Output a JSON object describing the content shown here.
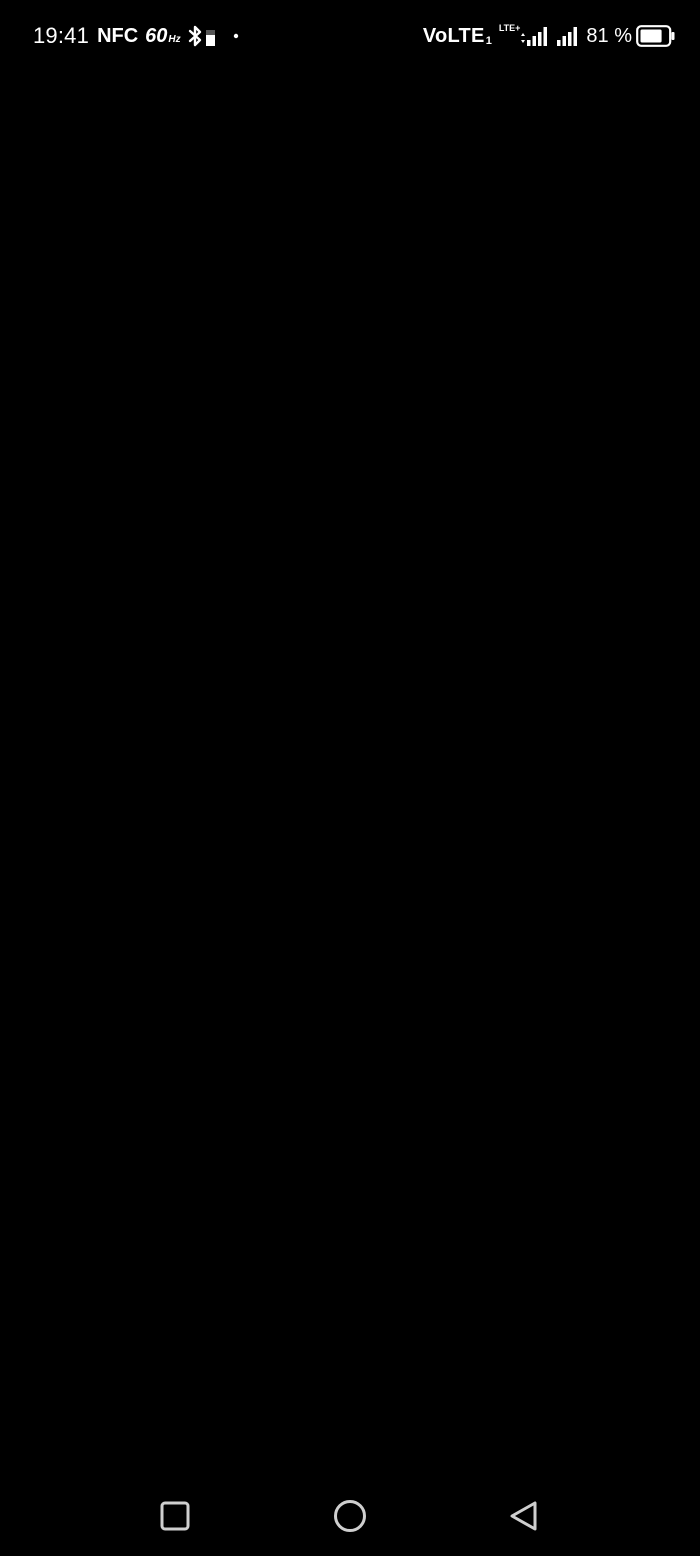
{
  "status_bar": {
    "time": "19:41",
    "nfc_label": "NFC",
    "refresh_rate": "60",
    "refresh_rate_unit": "Hz",
    "icons": [
      "bluetooth-icon",
      "notification-dot-icon",
      "lte-data-icon",
      "signal-icon",
      "signal-icon",
      "battery-icon"
    ],
    "volte_label": "VoLTE",
    "volte_sub": "1",
    "lte_label": "LTE+",
    "battery_percent_text": "81 %",
    "battery_level": 0.81
  },
  "navigation_bar": {
    "buttons": [
      "recents-button",
      "home-button",
      "back-button"
    ]
  },
  "colors": {
    "background": "#000000",
    "foreground": "#ffffff",
    "nav_icon": "#cfcfcf"
  }
}
